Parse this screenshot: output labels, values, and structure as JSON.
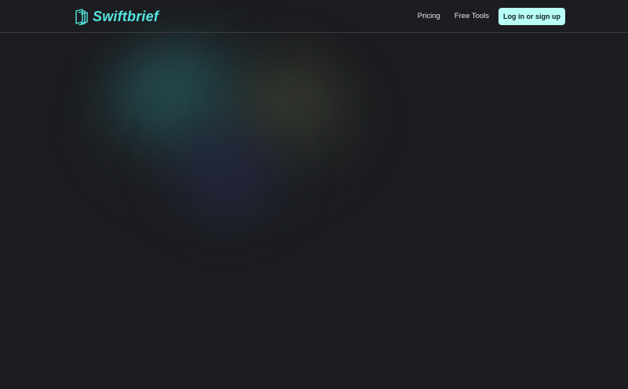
{
  "brand": {
    "name": "Swiftbrief",
    "logo_icon": "stacked-frames-icon",
    "accent_color": "#55e5df"
  },
  "nav": {
    "items": [
      {
        "label": "Pricing"
      },
      {
        "label": "Free Tools"
      }
    ],
    "cta_label": "Log in or sign up"
  },
  "theme": {
    "background": "#1c1d20",
    "button_background": "#b8fff7",
    "button_text": "#132023"
  }
}
